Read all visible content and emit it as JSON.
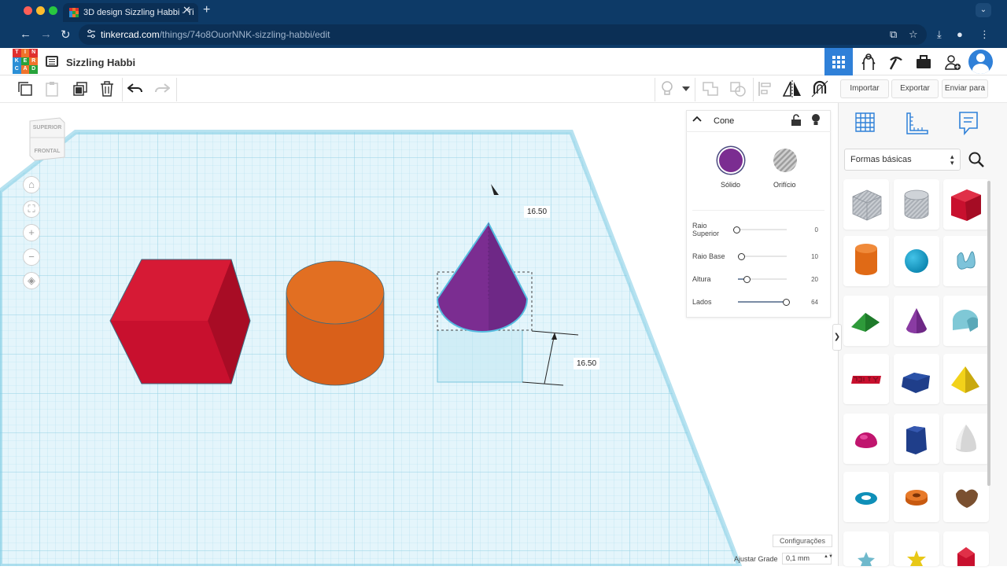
{
  "browser": {
    "tab_title": "3D design Sizzling Habbi - Ti",
    "url_host": "tinkercad.com",
    "url_path": "/things/74o8OuorNNK-sizzling-habbi/edit",
    "traffic_colors": [
      "#fe5f57",
      "#febc2e",
      "#28c840"
    ]
  },
  "app": {
    "logo_letters": [
      "T",
      "I",
      "N",
      "K",
      "E",
      "R",
      "C",
      "A",
      "D"
    ],
    "logo_colors": [
      "#e0302f",
      "#f0732b",
      "#e0302f",
      "#2b8fd6",
      "#27a23a",
      "#f0732b",
      "#2b8fd6",
      "#f0732b",
      "#27a23a"
    ],
    "design_title": "Sizzling Habbi",
    "accent": "#2f80d8"
  },
  "toolbar": {
    "import": "Importar",
    "export": "Exportar",
    "send_to": "Enviar para"
  },
  "viewcube": {
    "top": "SUPERIOR",
    "front": "FRONTAL"
  },
  "workplane": {
    "dim_top": "16.50",
    "dim_side": "16.50",
    "settings": "Configurações",
    "snap_label": "Ajustar Grade",
    "snap_value": "0,1 mm"
  },
  "inspector": {
    "title": "Cone",
    "solid_label": "Sólido",
    "hole_label": "Orifício",
    "solid_color": "#7b2d91",
    "params": [
      {
        "label": "Raio Superior",
        "value": "0",
        "level": 0.0
      },
      {
        "label": "Raio Base",
        "value": "10",
        "level": 0.1
      },
      {
        "label": "Altura",
        "value": "20",
        "level": 0.2
      },
      {
        "label": "Lados",
        "value": "64",
        "level": 1.0
      }
    ]
  },
  "panel": {
    "category": "Formas básicas"
  }
}
